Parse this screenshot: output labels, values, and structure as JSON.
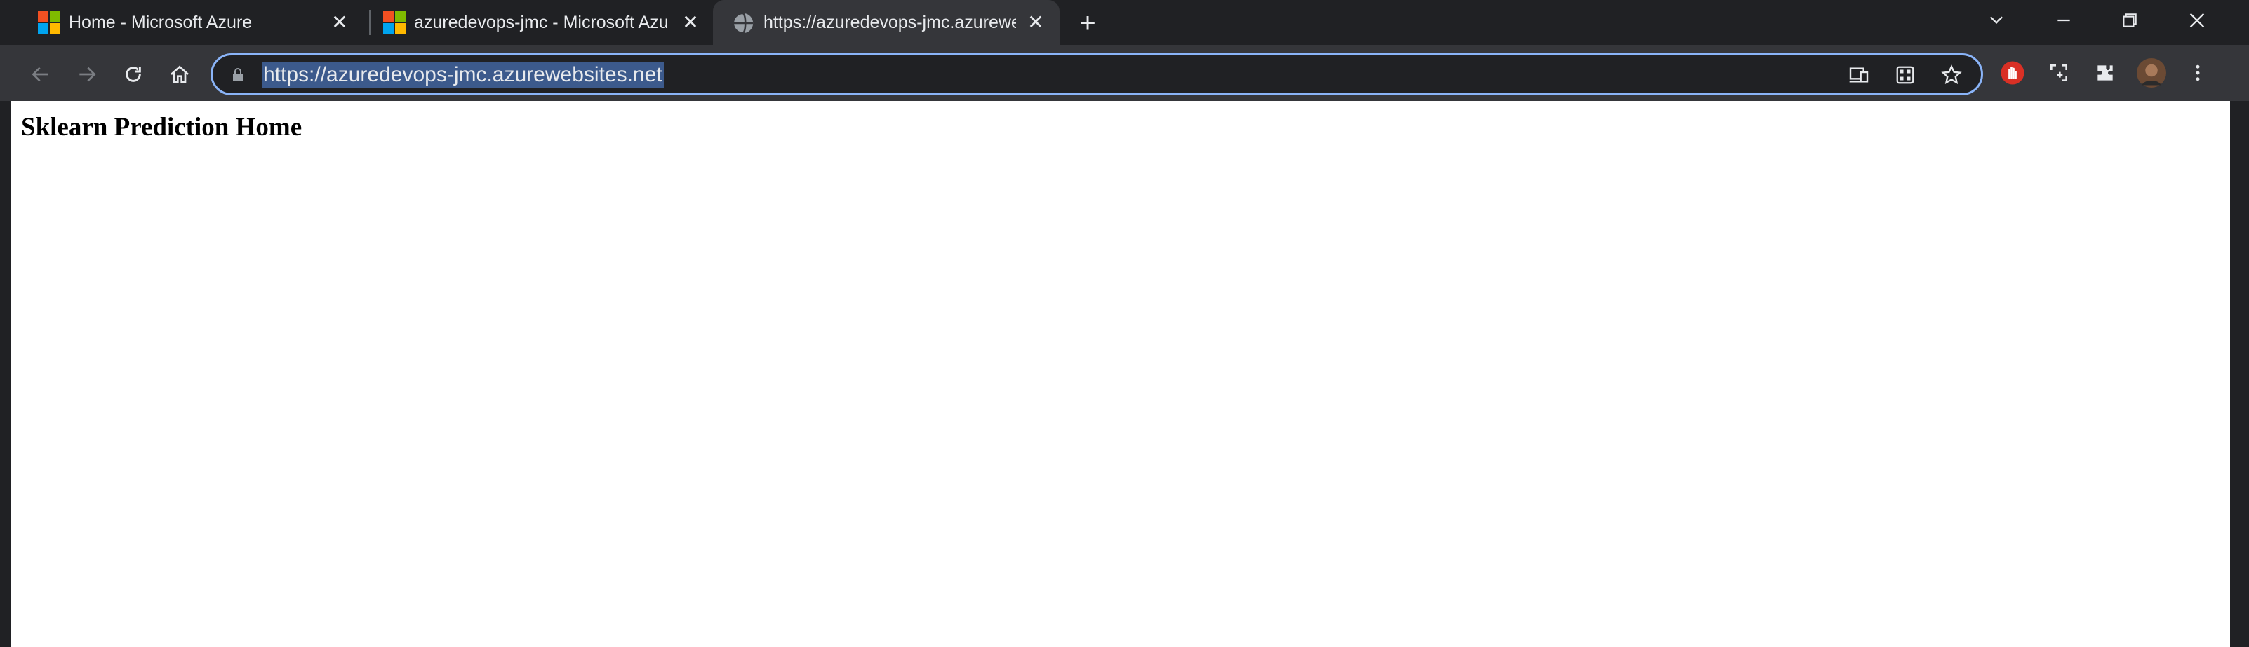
{
  "tabs": [
    {
      "title": "Home - Microsoft Azure",
      "favicon": "microsoft-logo-icon",
      "active": false
    },
    {
      "title": "azuredevops-jmc - Microsoft Azure",
      "favicon": "microsoft-logo-icon",
      "active": false
    },
    {
      "title": "https://azuredevops-jmc.azurewebsites.net",
      "favicon": "globe-icon",
      "active": true
    }
  ],
  "toolbar": {
    "url": "https://azuredevops-jmc.azurewebsites.net"
  },
  "page": {
    "heading": "Sklearn Prediction Home"
  },
  "colors": {
    "accent": "#8ab4f8",
    "toolbar_bg": "#35363a",
    "tabstrip_bg": "#202124"
  }
}
